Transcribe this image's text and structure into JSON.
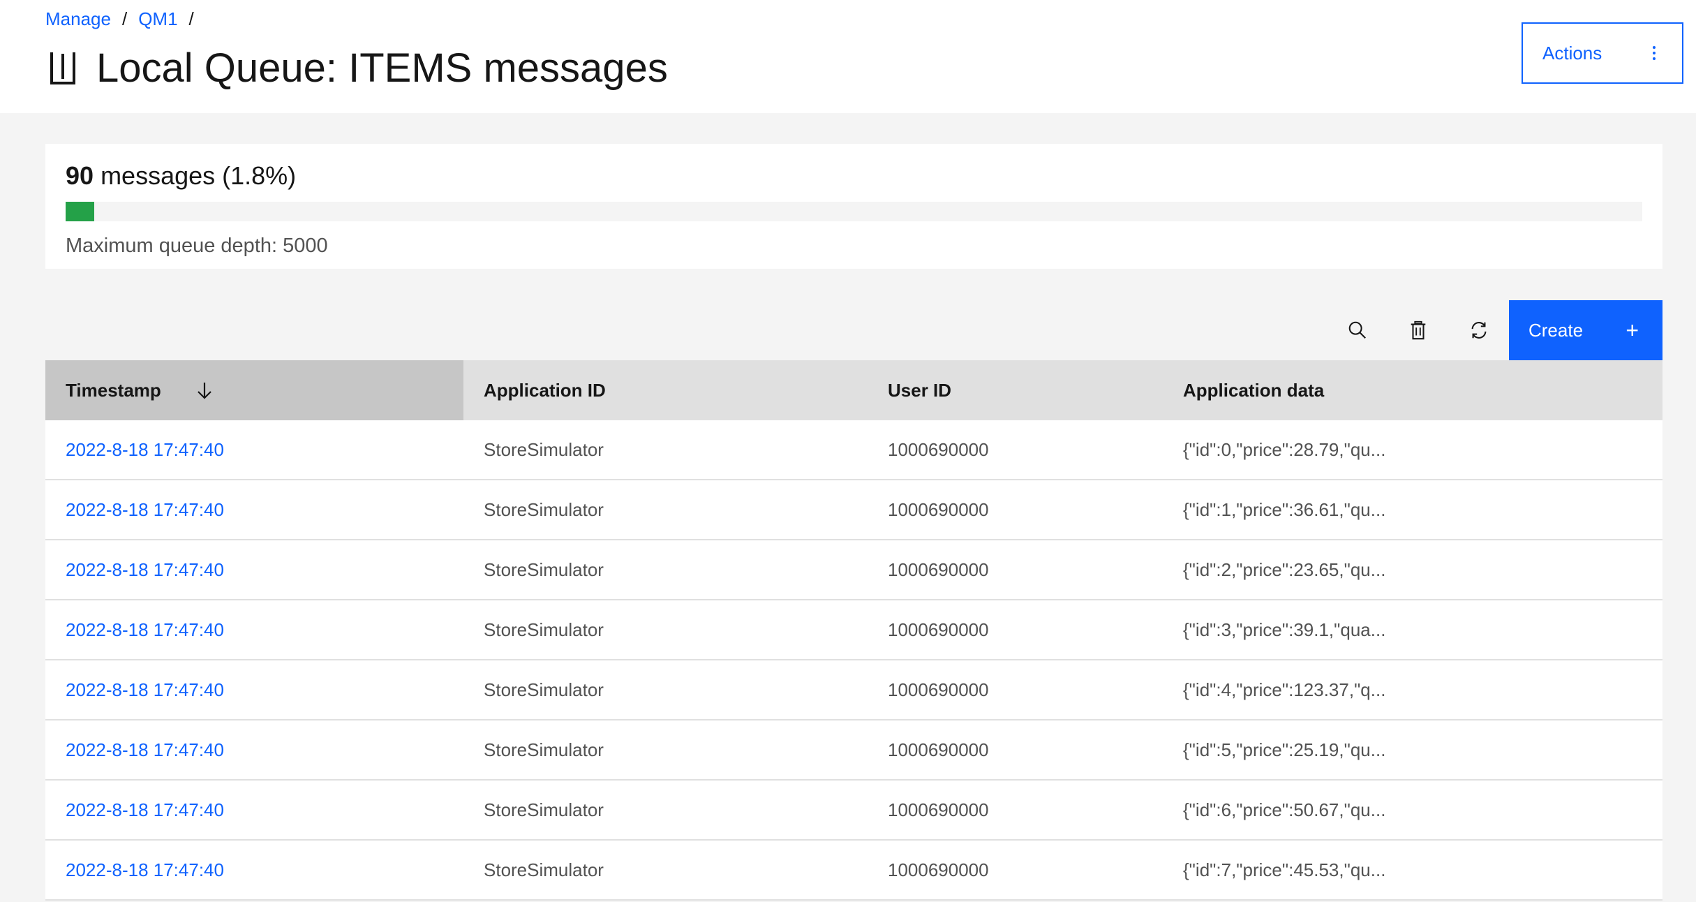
{
  "breadcrumb": {
    "items": [
      "Manage",
      "QM1"
    ],
    "separator": "/"
  },
  "title": "Local Queue: ITEMS messages",
  "title_icon": "queue-icon",
  "actions": {
    "label": "Actions",
    "icon": "overflow-menu-vertical-icon"
  },
  "depth": {
    "count": "90",
    "count_suffix": "messages (1.8%)",
    "fill_fraction": 0.018,
    "max_label": "Maximum queue depth: 5000",
    "fill_color": "#24a148"
  },
  "toolbar": {
    "icons": [
      "search-icon",
      "trash-icon",
      "refresh-icon"
    ],
    "create_label": "Create",
    "create_icon": "+"
  },
  "table": {
    "columns": [
      "Timestamp",
      "Application ID",
      "User ID",
      "Application data"
    ],
    "sort_column": "Timestamp",
    "sort_direction": "descending",
    "rows": [
      {
        "timestamp": "2022-8-18 17:47:40",
        "app_id": "StoreSimulator",
        "user_id": "1000690000",
        "data": "{\"id\":0,\"price\":28.79,\"qu..."
      },
      {
        "timestamp": "2022-8-18 17:47:40",
        "app_id": "StoreSimulator",
        "user_id": "1000690000",
        "data": "{\"id\":1,\"price\":36.61,\"qu..."
      },
      {
        "timestamp": "2022-8-18 17:47:40",
        "app_id": "StoreSimulator",
        "user_id": "1000690000",
        "data": "{\"id\":2,\"price\":23.65,\"qu..."
      },
      {
        "timestamp": "2022-8-18 17:47:40",
        "app_id": "StoreSimulator",
        "user_id": "1000690000",
        "data": "{\"id\":3,\"price\":39.1,\"qua..."
      },
      {
        "timestamp": "2022-8-18 17:47:40",
        "app_id": "StoreSimulator",
        "user_id": "1000690000",
        "data": "{\"id\":4,\"price\":123.37,\"q..."
      },
      {
        "timestamp": "2022-8-18 17:47:40",
        "app_id": "StoreSimulator",
        "user_id": "1000690000",
        "data": "{\"id\":5,\"price\":25.19,\"qu..."
      },
      {
        "timestamp": "2022-8-18 17:47:40",
        "app_id": "StoreSimulator",
        "user_id": "1000690000",
        "data": "{\"id\":6,\"price\":50.67,\"qu..."
      },
      {
        "timestamp": "2022-8-18 17:47:40",
        "app_id": "StoreSimulator",
        "user_id": "1000690000",
        "data": "{\"id\":7,\"price\":45.53,\"qu..."
      }
    ]
  }
}
